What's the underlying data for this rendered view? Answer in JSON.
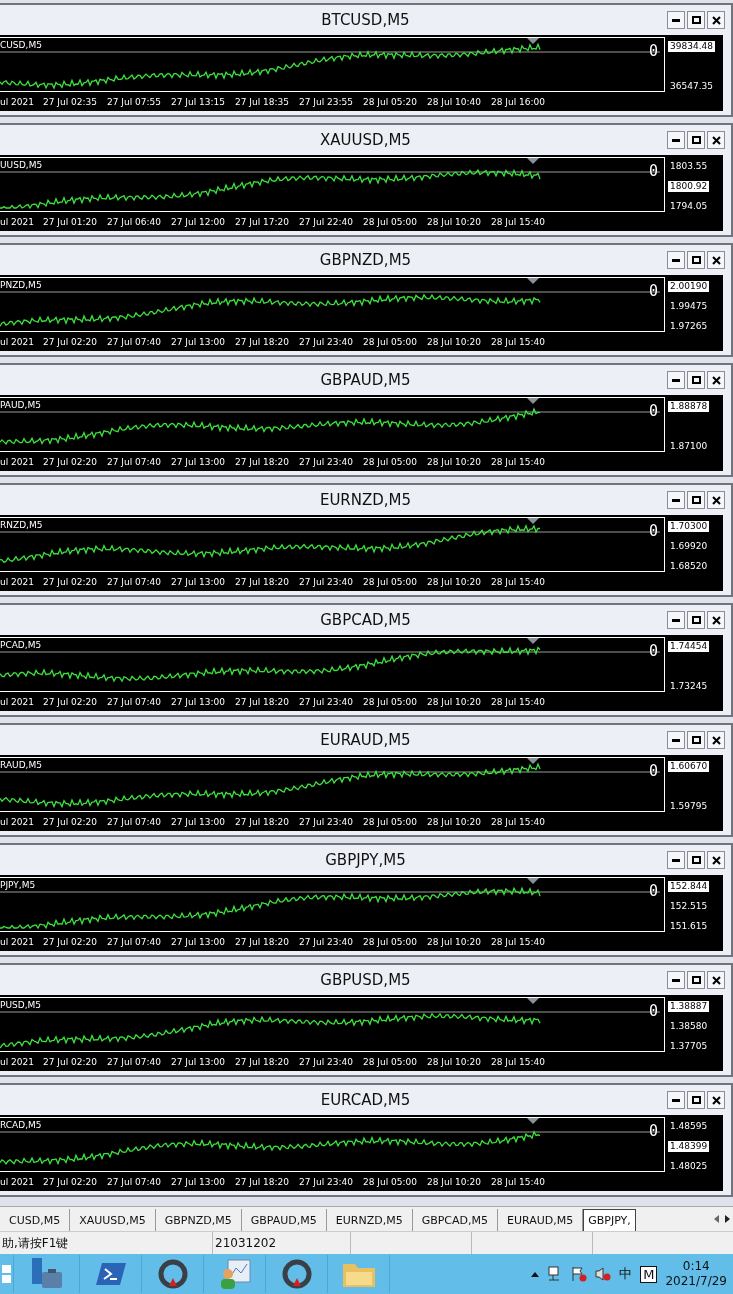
{
  "charts": [
    {
      "title": "BTCUSD,M5",
      "label": "CUSD,M5",
      "zero": "0",
      "price_scale": [
        {
          "kind": "current",
          "text": "39834.48"
        },
        {
          "kind": "tick",
          "text": "36547.35"
        }
      ],
      "times": [
        "ul 2021",
        "27 Jul 02:35",
        "27 Jul 07:55",
        "27 Jul 13:15",
        "27 Jul 18:35",
        "27 Jul 23:55",
        "28 Jul 05:20",
        "28 Jul 10:40",
        "28 Jul 16:00"
      ]
    },
    {
      "title": "XAUUSD,M5",
      "label": "UUSD,M5",
      "zero": "0",
      "price_scale": [
        {
          "kind": "tick",
          "text": "1803.55"
        },
        {
          "kind": "current",
          "text": "1800.92"
        },
        {
          "kind": "tick",
          "text": "1794.05"
        }
      ],
      "times": [
        "ul 2021",
        "27 Jul 01:20",
        "27 Jul 06:40",
        "27 Jul 12:00",
        "27 Jul 17:20",
        "27 Jul 22:40",
        "28 Jul 05:00",
        "28 Jul 10:20",
        "28 Jul 15:40"
      ]
    },
    {
      "title": "GBPNZD,M5",
      "label": "PNZD,M5",
      "zero": "0",
      "price_scale": [
        {
          "kind": "current",
          "text": "2.00190"
        },
        {
          "kind": "tick",
          "text": "1.99475"
        },
        {
          "kind": "tick",
          "text": "1.97265"
        }
      ],
      "times": [
        "ul 2021",
        "27 Jul 02:20",
        "27 Jul 07:40",
        "27 Jul 13:00",
        "27 Jul 18:20",
        "27 Jul 23:40",
        "28 Jul 05:00",
        "28 Jul 10:20",
        "28 Jul 15:40"
      ]
    },
    {
      "title": "GBPAUD,M5",
      "label": "PAUD,M5",
      "zero": "0",
      "price_scale": [
        {
          "kind": "current",
          "text": "1.88878"
        },
        {
          "kind": "tick",
          "text": "1.87100"
        }
      ],
      "times": [
        "ul 2021",
        "27 Jul 02:20",
        "27 Jul 07:40",
        "27 Jul 13:00",
        "27 Jul 18:20",
        "27 Jul 23:40",
        "28 Jul 05:00",
        "28 Jul 10:20",
        "28 Jul 15:40"
      ]
    },
    {
      "title": "EURNZD,M5",
      "label": "RNZD,M5",
      "zero": "0",
      "price_scale": [
        {
          "kind": "current",
          "text": "1.70300"
        },
        {
          "kind": "tick",
          "text": "1.69920"
        },
        {
          "kind": "tick",
          "text": "1.68520"
        }
      ],
      "times": [
        "ul 2021",
        "27 Jul 02:20",
        "27 Jul 07:40",
        "27 Jul 13:00",
        "27 Jul 18:20",
        "27 Jul 23:40",
        "28 Jul 05:00",
        "28 Jul 10:20",
        "28 Jul 15:40"
      ]
    },
    {
      "title": "GBPCAD,M5",
      "label": "PCAD,M5",
      "zero": "0",
      "price_scale": [
        {
          "kind": "current",
          "text": "1.74454"
        },
        {
          "kind": "tick",
          "text": "1.73245"
        }
      ],
      "times": [
        "ul 2021",
        "27 Jul 02:20",
        "27 Jul 07:40",
        "27 Jul 13:00",
        "27 Jul 18:20",
        "27 Jul 23:40",
        "28 Jul 05:00",
        "28 Jul 10:20",
        "28 Jul 15:40"
      ]
    },
    {
      "title": "EURAUD,M5",
      "label": "RAUD,M5",
      "zero": "0",
      "price_scale": [
        {
          "kind": "current",
          "text": "1.60670"
        },
        {
          "kind": "tick",
          "text": "1.59795"
        }
      ],
      "times": [
        "ul 2021",
        "27 Jul 02:20",
        "27 Jul 07:40",
        "27 Jul 13:00",
        "27 Jul 18:20",
        "27 Jul 23:40",
        "28 Jul 05:00",
        "28 Jul 10:20",
        "28 Jul 15:40"
      ]
    },
    {
      "title": "GBPJPY,M5",
      "label": "PJPY,M5",
      "zero": "0",
      "price_scale": [
        {
          "kind": "current",
          "text": "152.844"
        },
        {
          "kind": "tick",
          "text": "152.515"
        },
        {
          "kind": "tick",
          "text": "151.615"
        }
      ],
      "times": [
        "ul 2021",
        "27 Jul 02:20",
        "27 Jul 07:40",
        "27 Jul 13:00",
        "27 Jul 18:20",
        "27 Jul 23:40",
        "28 Jul 05:00",
        "28 Jul 10:20",
        "28 Jul 15:40"
      ]
    },
    {
      "title": "GBPUSD,M5",
      "label": "PUSD,M5",
      "zero": "0",
      "price_scale": [
        {
          "kind": "current",
          "text": "1.38887"
        },
        {
          "kind": "tick",
          "text": "1.38580"
        },
        {
          "kind": "tick",
          "text": "1.37705"
        }
      ],
      "times": [
        "ul 2021",
        "27 Jul 02:20",
        "27 Jul 07:40",
        "27 Jul 13:00",
        "27 Jul 18:20",
        "27 Jul 23:40",
        "28 Jul 05:00",
        "28 Jul 10:20",
        "28 Jul 15:40"
      ]
    },
    {
      "title": "EURCAD,M5",
      "label": "RCAD,M5",
      "zero": "0",
      "price_scale": [
        {
          "kind": "tick",
          "text": "1.48595"
        },
        {
          "kind": "current",
          "text": "1.48399"
        },
        {
          "kind": "tick",
          "text": "1.48025"
        }
      ],
      "times": [
        "ul 2021",
        "27 Jul 02:20",
        "27 Jul 07:40",
        "27 Jul 13:00",
        "27 Jul 18:20",
        "27 Jul 23:40",
        "28 Jul 05:00",
        "28 Jul 10:20",
        "28 Jul 15:40"
      ]
    }
  ],
  "tabs": [
    {
      "label": "CUSD,M5",
      "selected": false
    },
    {
      "label": "XAUUSD,M5",
      "selected": false
    },
    {
      "label": "GBPNZD,M5",
      "selected": false
    },
    {
      "label": "GBPAUD,M5",
      "selected": false
    },
    {
      "label": "EURNZD,M5",
      "selected": false
    },
    {
      "label": "GBPCAD,M5",
      "selected": false
    },
    {
      "label": "EURAUD,M5",
      "selected": false
    },
    {
      "label": "GBPJPY,",
      "selected": true
    }
  ],
  "status_bar": [
    "助,请按F1键",
    "21031202"
  ],
  "taskbar": {
    "tray": [
      "中",
      "M"
    ],
    "time": "0:14",
    "date": "2021/7/29"
  }
}
